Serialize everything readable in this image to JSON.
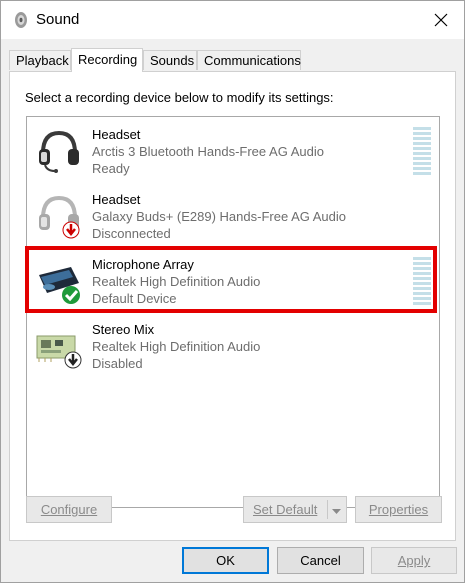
{
  "window": {
    "title": "Sound"
  },
  "tabs": [
    {
      "label": "Playback"
    },
    {
      "label": "Recording",
      "active": true
    },
    {
      "label": "Sounds"
    },
    {
      "label": "Communications"
    }
  ],
  "instruction": "Select a recording device below to modify its settings:",
  "devices": [
    {
      "name": "Headset",
      "description": "Arctis 3 Bluetooth Hands-Free AG Audio",
      "status": "Ready",
      "icon": "headset-icon",
      "meter": true
    },
    {
      "name": "Headset",
      "description": "Galaxy Buds+ (E289) Hands-Free AG Audio",
      "status": "Disconnected",
      "icon": "headset-disconnected-icon",
      "badge": "red-down-arrow"
    },
    {
      "name": "Microphone Array",
      "description": "Realtek High Definition Audio",
      "status": "Default Device",
      "icon": "microphone-array-icon",
      "badge": "green-check",
      "selected": true,
      "meter": true
    },
    {
      "name": "Stereo Mix",
      "description": "Realtek High Definition Audio",
      "status": "Disabled",
      "icon": "circuit-board-icon",
      "badge": "black-down-arrow"
    }
  ],
  "buttons": {
    "configure": "Configure",
    "set_default": "Set Default",
    "properties": "Properties",
    "ok": "OK",
    "cancel": "Cancel",
    "apply": "Apply"
  },
  "colors": {
    "highlight": "#e30000",
    "accent": "#0078d7",
    "meter": "#c4dfe8"
  }
}
